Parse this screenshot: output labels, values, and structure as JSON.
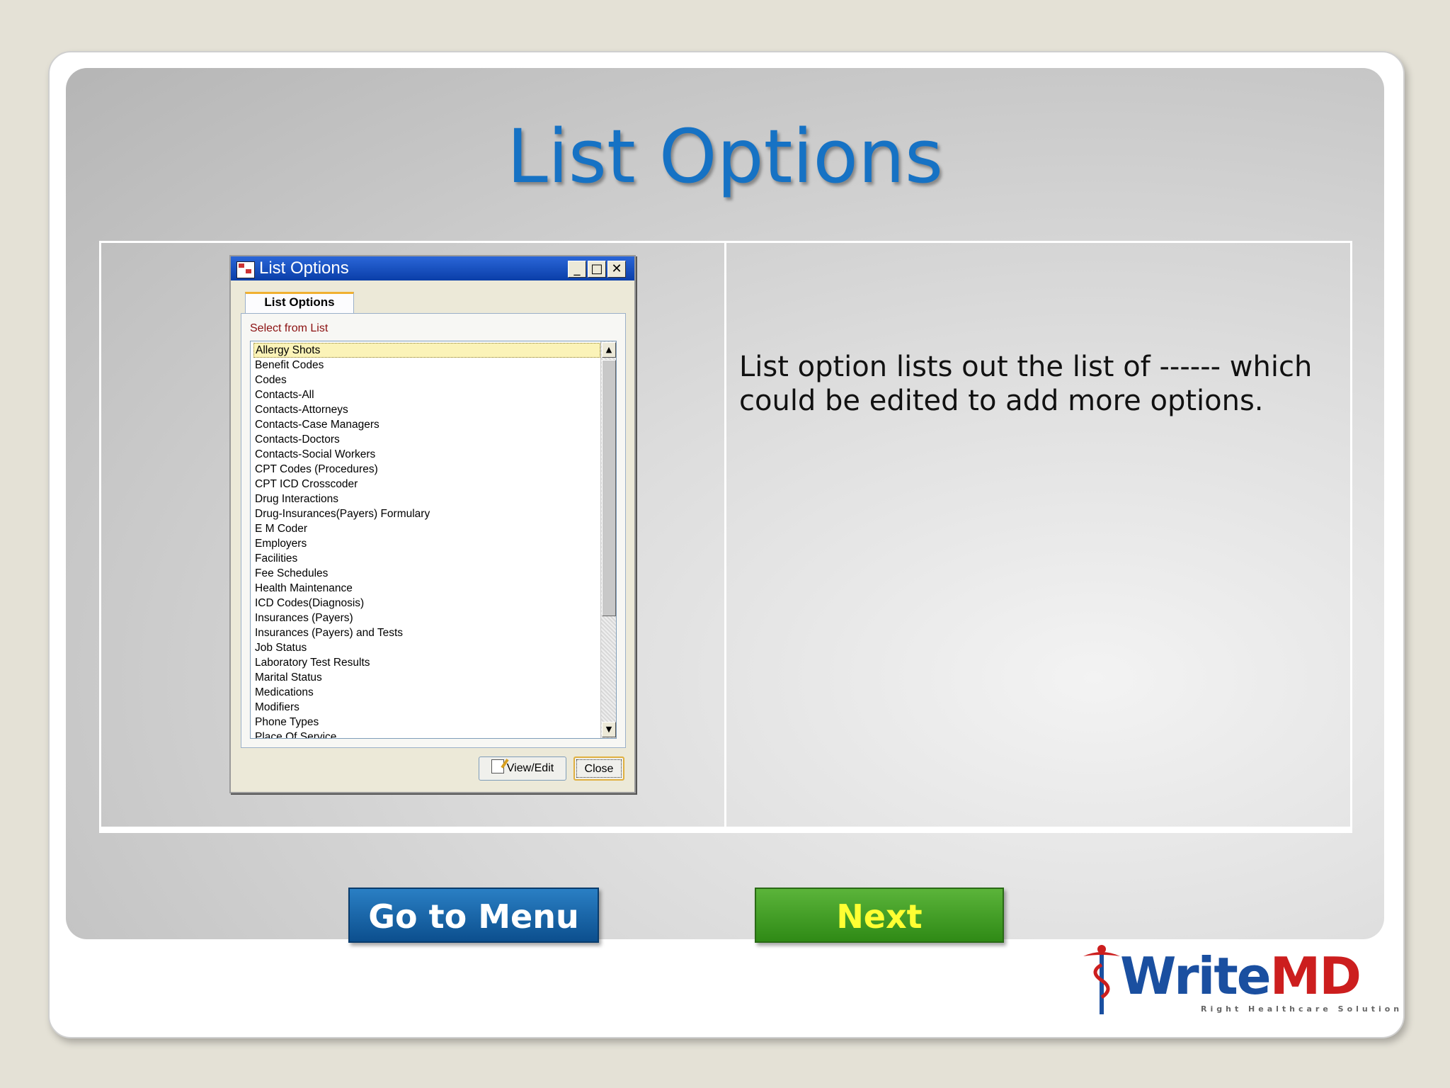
{
  "slide": {
    "title": "List Options",
    "description": "List option lists out the list of ------ which could be edited to add more options."
  },
  "dialog": {
    "window_title": "List Options",
    "minimize_glyph": "_",
    "maximize_glyph": "□",
    "close_glyph": "✕",
    "tab_label": "List Options",
    "select_label": "Select from List",
    "items": [
      "Allergy Shots",
      "Benefit Codes",
      "Codes",
      "Contacts-All",
      "Contacts-Attorneys",
      "Contacts-Case Managers",
      "Contacts-Doctors",
      "Contacts-Social Workers",
      "CPT Codes (Procedures)",
      "CPT ICD Crosscoder",
      "Drug Interactions",
      "Drug-Insurances(Payers) Formulary",
      "E M Coder",
      "Employers",
      "Facilities",
      "Fee Schedules",
      "Health Maintenance",
      "ICD Codes(Diagnosis)",
      "Insurances (Payers)",
      "Insurances (Payers) and Tests",
      "Job Status",
      "Laboratory Test Results",
      "Marital Status",
      "Medications",
      "Modifiers",
      "Phone Types",
      "Place Of Service"
    ],
    "selected_item": "Allergy Shots",
    "view_edit_label": "View/Edit",
    "close_label": "Close",
    "scroll_up_glyph": "▲",
    "scroll_down_glyph": "▼"
  },
  "nav": {
    "menu_label": "Go to Menu",
    "next_label": "Next"
  },
  "logo": {
    "name_part1": "Write",
    "name_part2": "MD",
    "tagline": "Right Healthcare Solution"
  },
  "colors": {
    "title_blue": "#1672c4",
    "menu_button": "#1a6aaa",
    "next_button": "#46a028",
    "next_text": "#ffff33",
    "titlebar": "#0a46c0"
  }
}
